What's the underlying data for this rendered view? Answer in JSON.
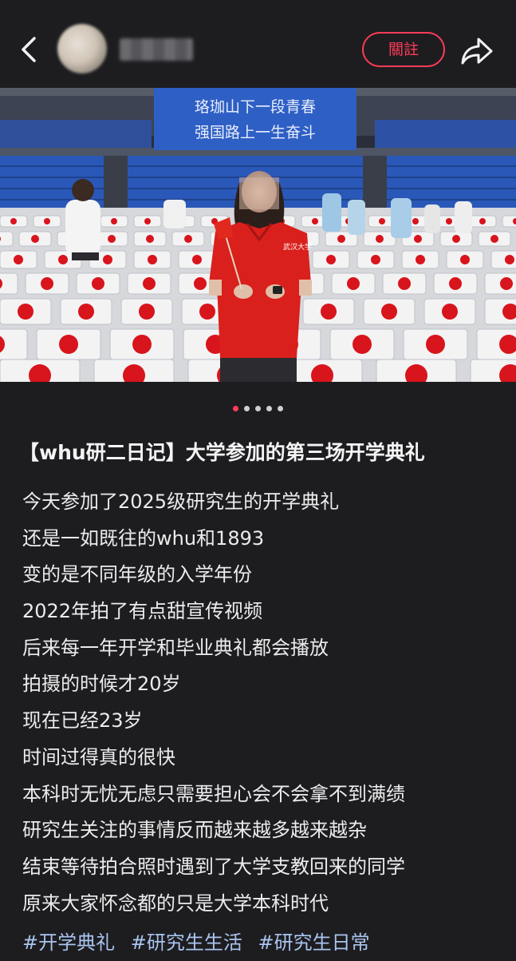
{
  "header": {
    "back_icon": "chevron-left-icon",
    "avatar": "blurred-avatar",
    "username": "",
    "follow_label": "關註",
    "share_icon": "share-arrow-icon",
    "accent_color": "#ff3b57"
  },
  "photo": {
    "banner_line1": "珞珈山下一段青春",
    "banner_line2": "强国路上一生奋斗",
    "shirt_text": "武汉大学",
    "page_indicator": {
      "count": 5,
      "active": 1
    }
  },
  "post": {
    "title": "【whu研二日记】大学参加的第三场开学典礼",
    "lines": [
      "今天参加了2025级研究生的开学典礼",
      "还是一如既往的whu和1893",
      "变的是不同年级的入学年份",
      "2022年拍了有点甜宣传视频",
      "后来每一年开学和毕业典礼都会播放",
      "拍摄的时候才20岁",
      "现在已经23岁",
      "时间过得真的很快",
      "本科时无忧无虑只需要担心会不会拿不到满绩",
      "研究生关注的事情反而越来越多越来越杂",
      "结束等待拍合照时遇到了大学支教回来的同学",
      "原来大家怀念都的只是大学本科时代"
    ],
    "tags": [
      "#开学典礼",
      "#研究生生活",
      "#研究生日常"
    ]
  }
}
